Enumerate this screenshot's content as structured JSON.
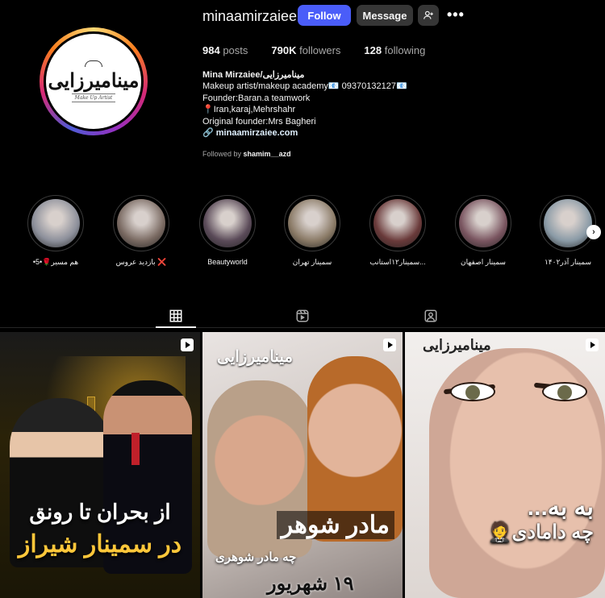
{
  "header": {
    "username": "minaamirzaiee",
    "follow_label": "Follow",
    "message_label": "Message",
    "more_label": "•••",
    "avatar_logo_text": "مینامیرزایی",
    "avatar_logo_sub": "Make Up Artist"
  },
  "stats": {
    "posts_count": "984",
    "posts_label": "posts",
    "followers_count": "790K",
    "followers_label": "followers",
    "following_count": "128",
    "following_label": "following"
  },
  "bio": {
    "name": "Mina Mirzaiee/مینامیرزایی",
    "line1": "Makeup artist/makeup academy📧 09370132127📧",
    "line2": "Founder:Baran.a teamwork",
    "line3": "📍Iran,karaj,Mehrshahr",
    "line4": "Original founder:Mrs Bagheri",
    "link": "minaamirzaiee.com",
    "followed_prefix": "Followed by",
    "followed_user": "shamim__azd"
  },
  "highlights": [
    {
      "label": "•هم مسیر🌹•5",
      "color": "#8c8f9a"
    },
    {
      "label": "بازدید عروس ❌",
      "color": "#7a6a62"
    },
    {
      "label": "Beautyworld",
      "color": "#5a4a58"
    },
    {
      "label": "سمینار تهران",
      "color": "#8a7a66"
    },
    {
      "label": "سمینار۱۲استانب...",
      "color": "#6a3a3a"
    },
    {
      "label": "سمینار اصفهان",
      "color": "#7a5560"
    },
    {
      "label": "سمینار آذر۱۴۰۲",
      "color": "#8a9aa6"
    }
  ],
  "highlights_next": "›",
  "tabs": {
    "posts": "posts-grid",
    "reels": "reels",
    "tagged": "tagged"
  },
  "posts": [
    {
      "caption1": "از بحران تا رونق",
      "caption2": "در سمینار شیراز"
    },
    {
      "logo": "مینامیرزایی",
      "caption1": "مادر شوهر",
      "caption2": "چه مادر شوهری",
      "caption3": "۱۹ شهریور"
    },
    {
      "logo": "مینامیرزایی",
      "caption1": "به به...",
      "caption2": "چه دامادی🤵"
    }
  ]
}
